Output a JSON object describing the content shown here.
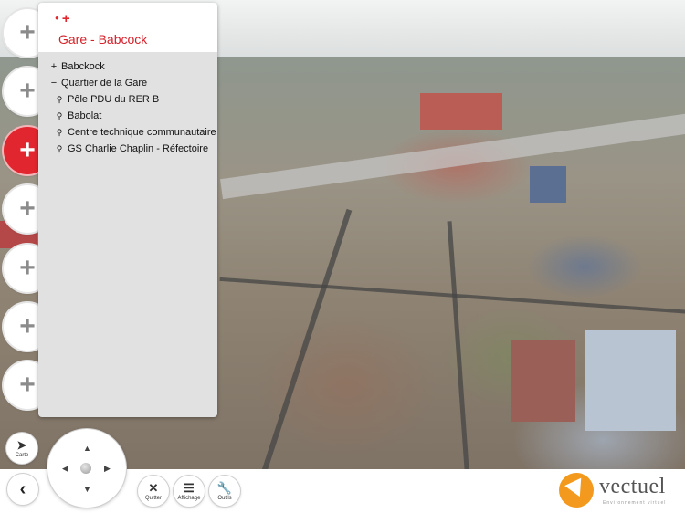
{
  "panel": {
    "title": "Gare - Babcock",
    "tree": [
      {
        "symbol": "+",
        "label": "Babckock",
        "level": 0
      },
      {
        "symbol": "−",
        "label": "Quartier de la Gare",
        "level": 0
      },
      {
        "symbol": "⚲",
        "label": "Pôle PDU du RER B",
        "level": 1
      },
      {
        "symbol": "⚲",
        "label": "Babolat",
        "level": 1
      },
      {
        "symbol": "⚲",
        "label": "Centre technique communautaire",
        "level": 1
      },
      {
        "symbol": "⚲",
        "label": "GS Charlie Chaplin - Réfectoire",
        "level": 1
      }
    ]
  },
  "left_buttons": {
    "symbol": "+",
    "count": 7,
    "active_index": 2
  },
  "toolbar": {
    "carte_label": "Carte",
    "quitter_label": "Quitter",
    "affichage_label": "Affichage",
    "outils_label": "Outils"
  },
  "logo": {
    "name": "vectuel",
    "tagline": "Environnement virtuel"
  },
  "colors": {
    "accent": "#e1262f",
    "logo_orange": "#f39a1e"
  }
}
